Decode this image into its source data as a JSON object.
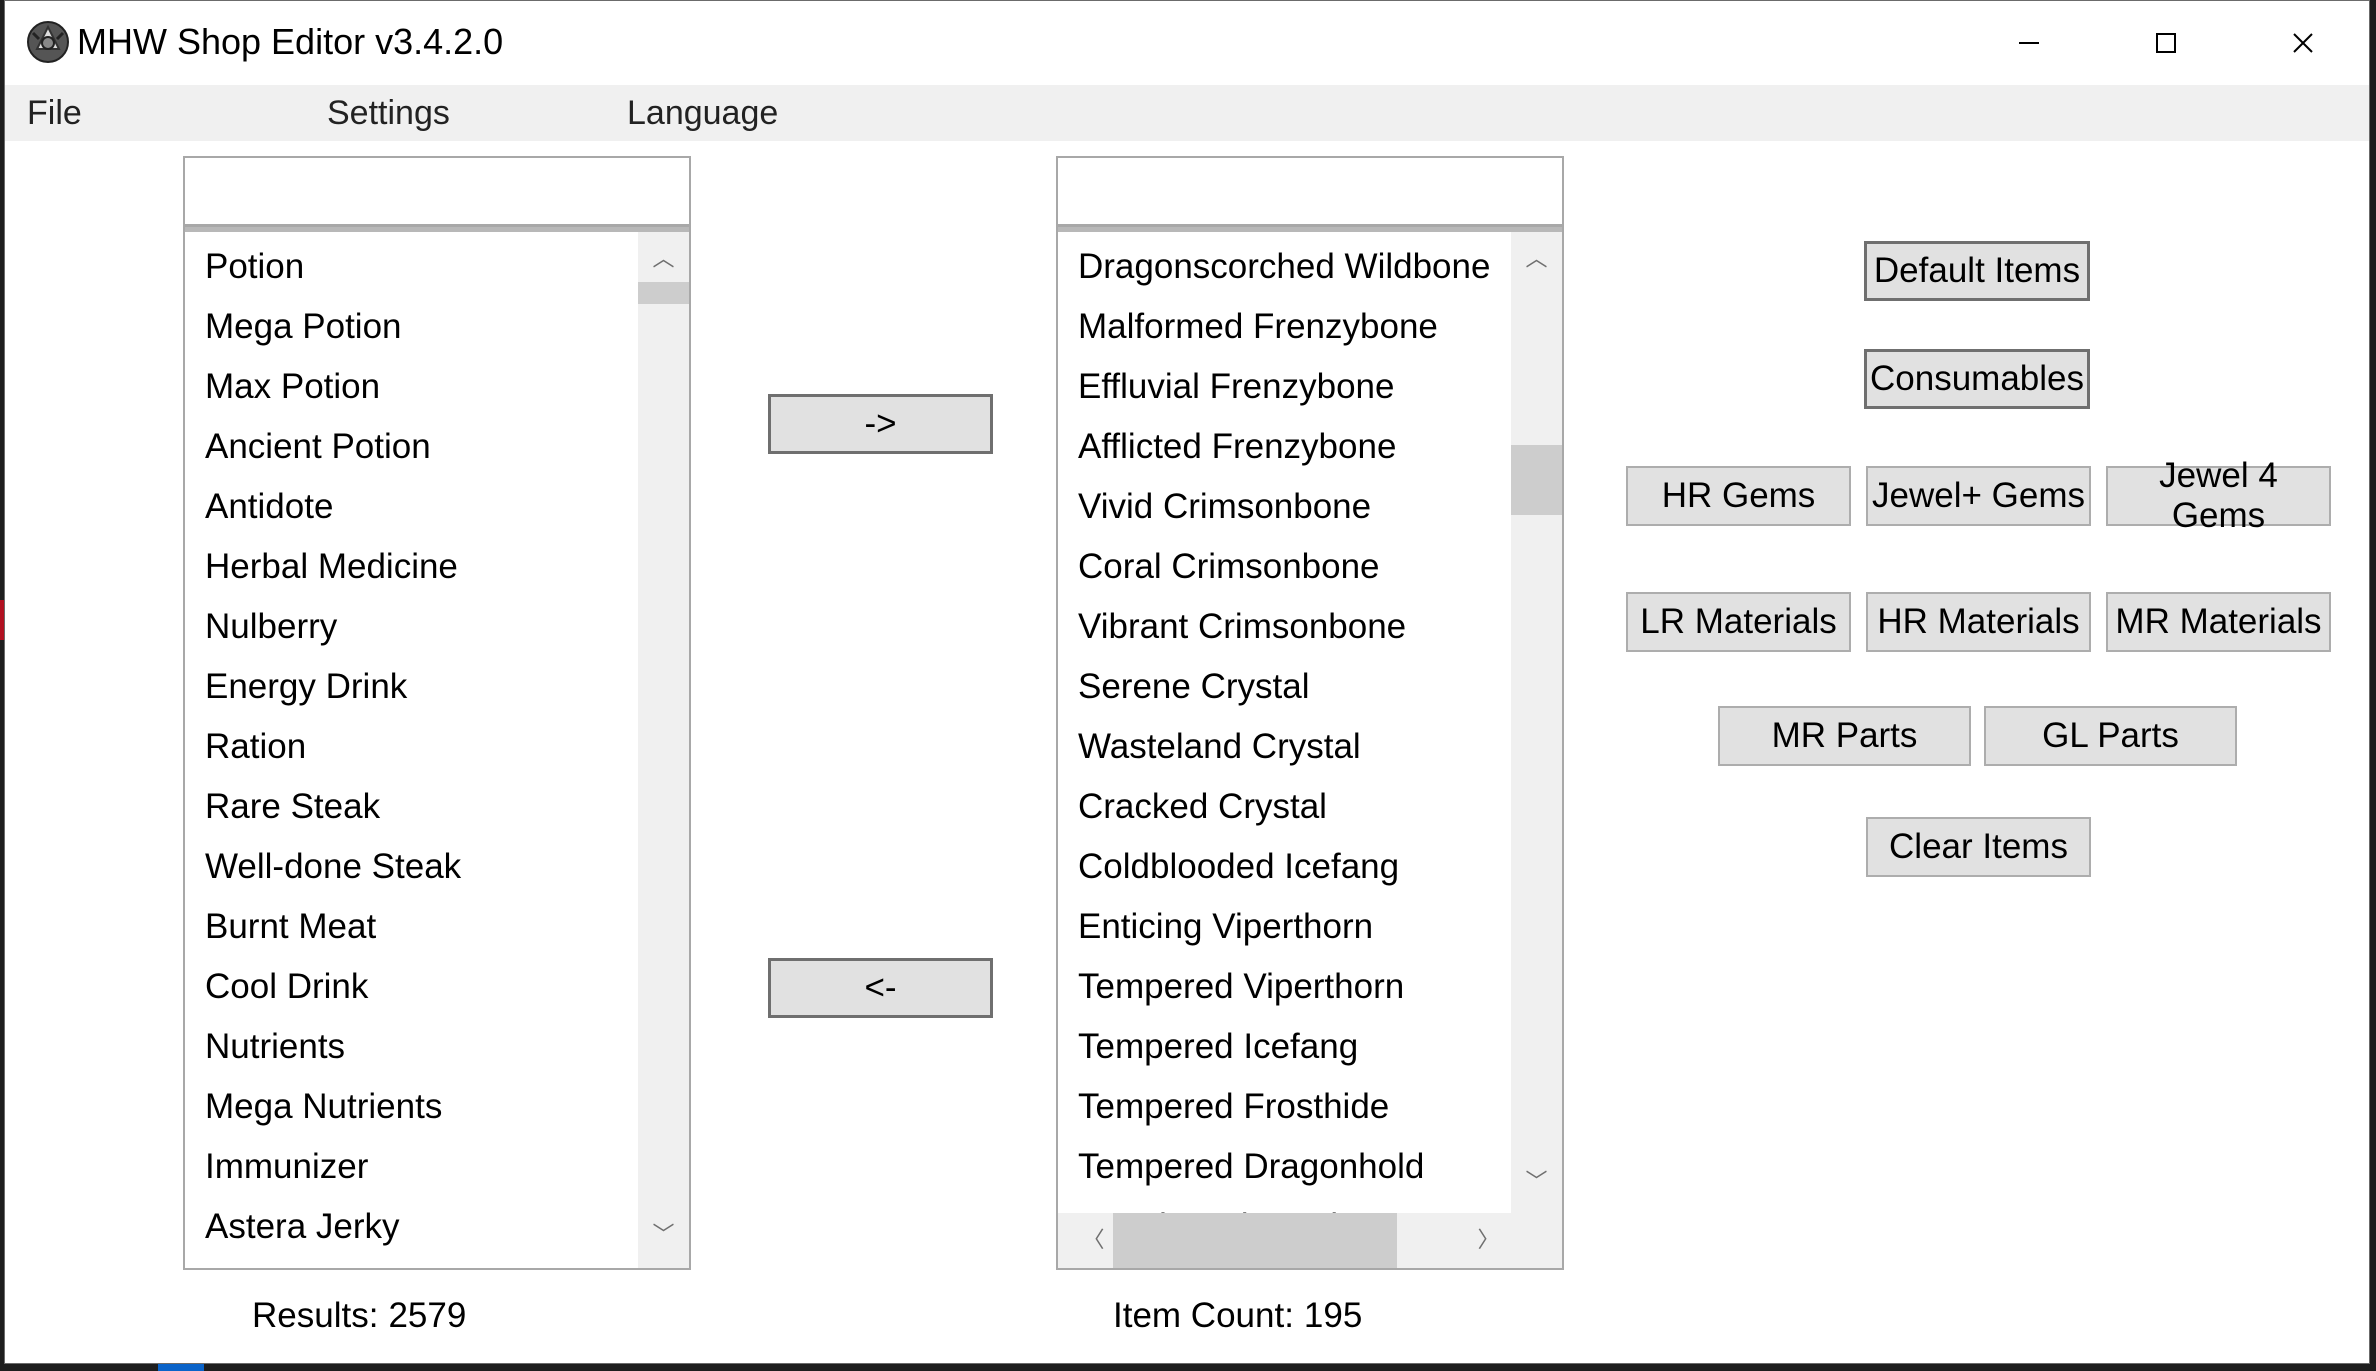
{
  "window": {
    "title": "MHW Shop Editor v3.4.2.0",
    "icons": {
      "app": "app-crest-icon",
      "minimize": "minimize-icon",
      "maximize": "maximize-icon",
      "close": "close-icon"
    }
  },
  "menu": [
    "File",
    "Settings",
    "Language"
  ],
  "left_panel": {
    "search_value": "",
    "items": [
      "Potion",
      "Mega Potion",
      "Max Potion",
      "Ancient Potion",
      "Antidote",
      "Herbal Medicine",
      "Nulberry",
      "Energy Drink",
      "Ration",
      "Rare Steak",
      "Well-done Steak",
      "Burnt Meat",
      "Cool Drink",
      "Nutrients",
      "Mega Nutrients",
      "Immunizer",
      "Astera Jerky"
    ],
    "results_label": "Results:",
    "results_value": "2579"
  },
  "transfer": {
    "add_label": "->",
    "remove_label": "<-"
  },
  "right_panel": {
    "search_value": "",
    "items": [
      "Dragonscorched Wildbone",
      "Malformed Frenzybone",
      "Effluvial Frenzybone",
      "Afflicted Frenzybone",
      "Vivid Crimsonbone",
      "Coral Crimsonbone",
      "Vibrant Crimsonbone",
      "Serene Crystal",
      "Wasteland Crystal",
      "Cracked Crystal",
      "Coldblooded Icefang",
      "Enticing Viperthorn",
      "Tempered Viperthorn",
      "Tempered Icefang",
      "Tempered Frosthide",
      "Tempered Dragonhold",
      "Weathered Crysh..."
    ],
    "count_label": "Item Count:",
    "count_value": "195"
  },
  "presets": {
    "default_items": "Default Items",
    "consumables": "Consumables",
    "hr_gems": "HR Gems",
    "jewel_plus_gems": "Jewel+ Gems",
    "jewel_4_gems": "Jewel 4 Gems",
    "lr_materials": "LR Materials",
    "hr_materials": "HR Materials",
    "mr_materials": "MR Materials",
    "mr_parts": "MR Parts",
    "gl_parts": "GL Parts",
    "clear_items": "Clear Items"
  },
  "scroll": {
    "left_vertical_position": 0.0,
    "right_vertical_position": 0.2,
    "right_horizontal_position": 0.0
  }
}
